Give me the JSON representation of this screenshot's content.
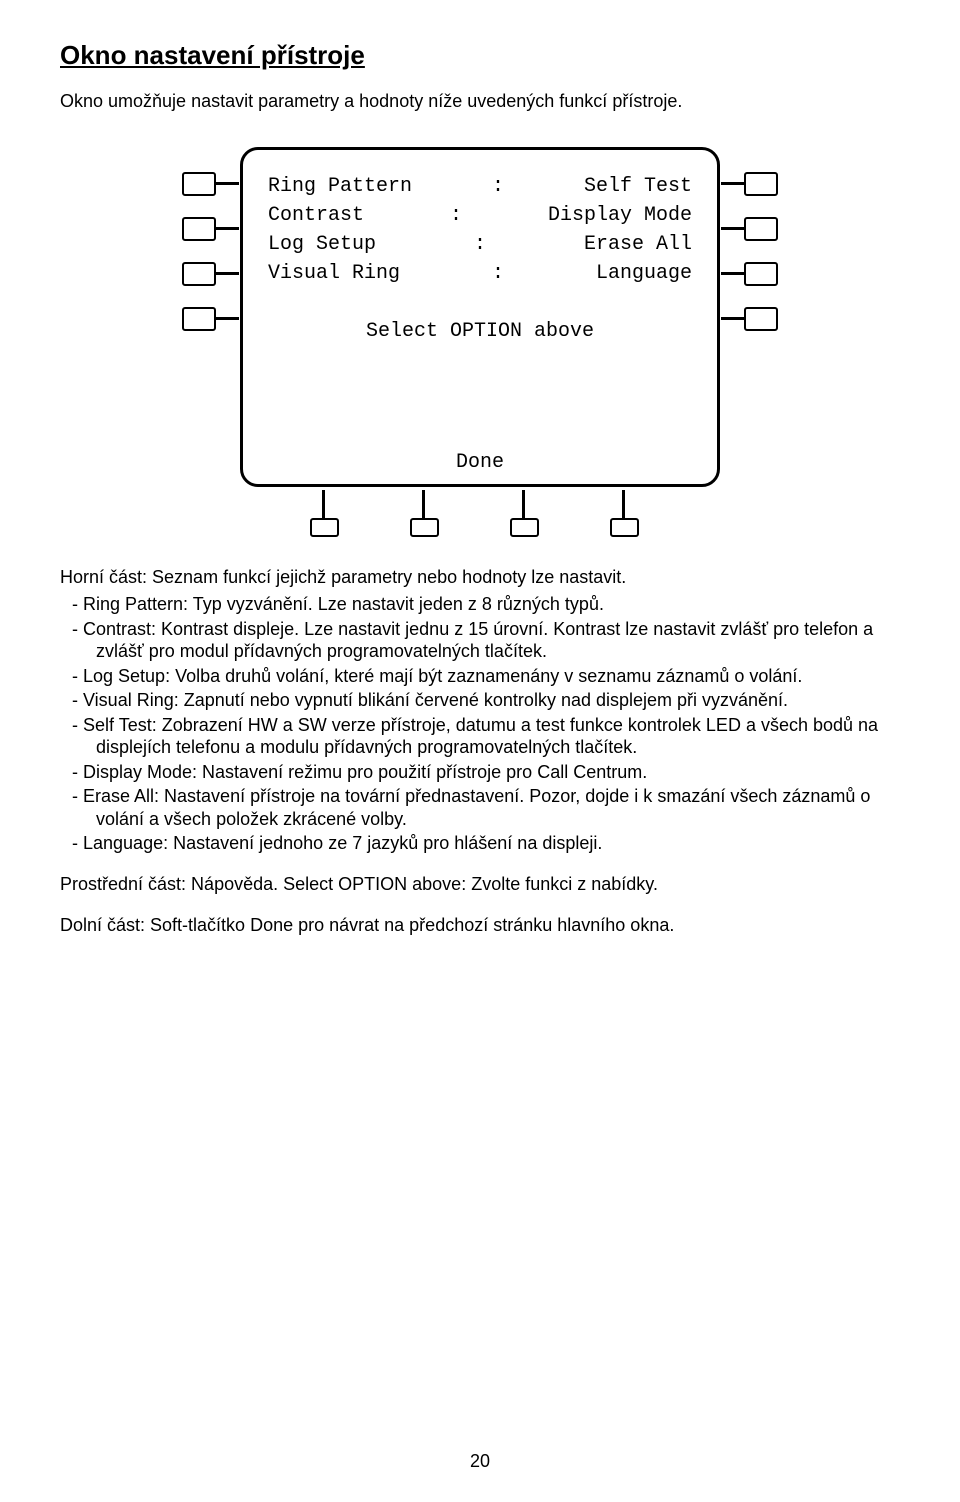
{
  "heading": "Okno nastavení přístroje",
  "intro": "Okno umožňuje nastavit parametry a hodnoty níže uvedených funkcí přístroje.",
  "device": {
    "rows": [
      {
        "left": "Ring Pattern",
        "right": "Self Test"
      },
      {
        "left": "Contrast",
        "right": "Display Mode"
      },
      {
        "left": "Log Setup",
        "right": "Erase All"
      },
      {
        "left": "Visual Ring",
        "right": "Language"
      }
    ],
    "prompt": "Select OPTION above",
    "done": "Done"
  },
  "subheading": "Horní část: Seznam funkcí jejichž parametry nebo hodnoty lze nastavit.",
  "items": [
    "Ring Pattern: Typ vyzvánění. Lze nastavit jeden z 8 různých typů.",
    "Contrast: Kontrast displeje. Lze nastavit jednu z 15 úrovní. Kontrast lze nastavit zvlášť pro telefon a zvlášť pro modul přídavných programovatelných tlačítek.",
    "Log Setup: Volba druhů volání, které mají být zaznamenány v seznamu záznamů o volání.",
    "Visual Ring: Zapnutí nebo vypnutí blikání červené kontrolky nad displejem při vyzvánění.",
    "Self Test: Zobrazení HW a SW verze přístroje, datumu a test funkce kontrolek LED a všech bodů na displejích telefonu a modulu přídavných programovatelných tlačítek.",
    "Display Mode: Nastavení režimu pro použití přístroje pro Call Centrum.",
    "Erase All: Nastavení přístroje na tovární přednastavení. Pozor, dojde i k smazání všech záznamů o volání a všech položek zkrácené volby.",
    "Language: Nastavení jednoho ze 7 jazyků pro hlášení na displeji."
  ],
  "middle_para": "Prostřední část: Nápověda. Select OPTION above: Zvolte funkci z nabídky.",
  "bottom_para": "Dolní část: Soft-tlačítko Done pro návrat na předchozí stránku hlavního okna.",
  "page_number": "20"
}
